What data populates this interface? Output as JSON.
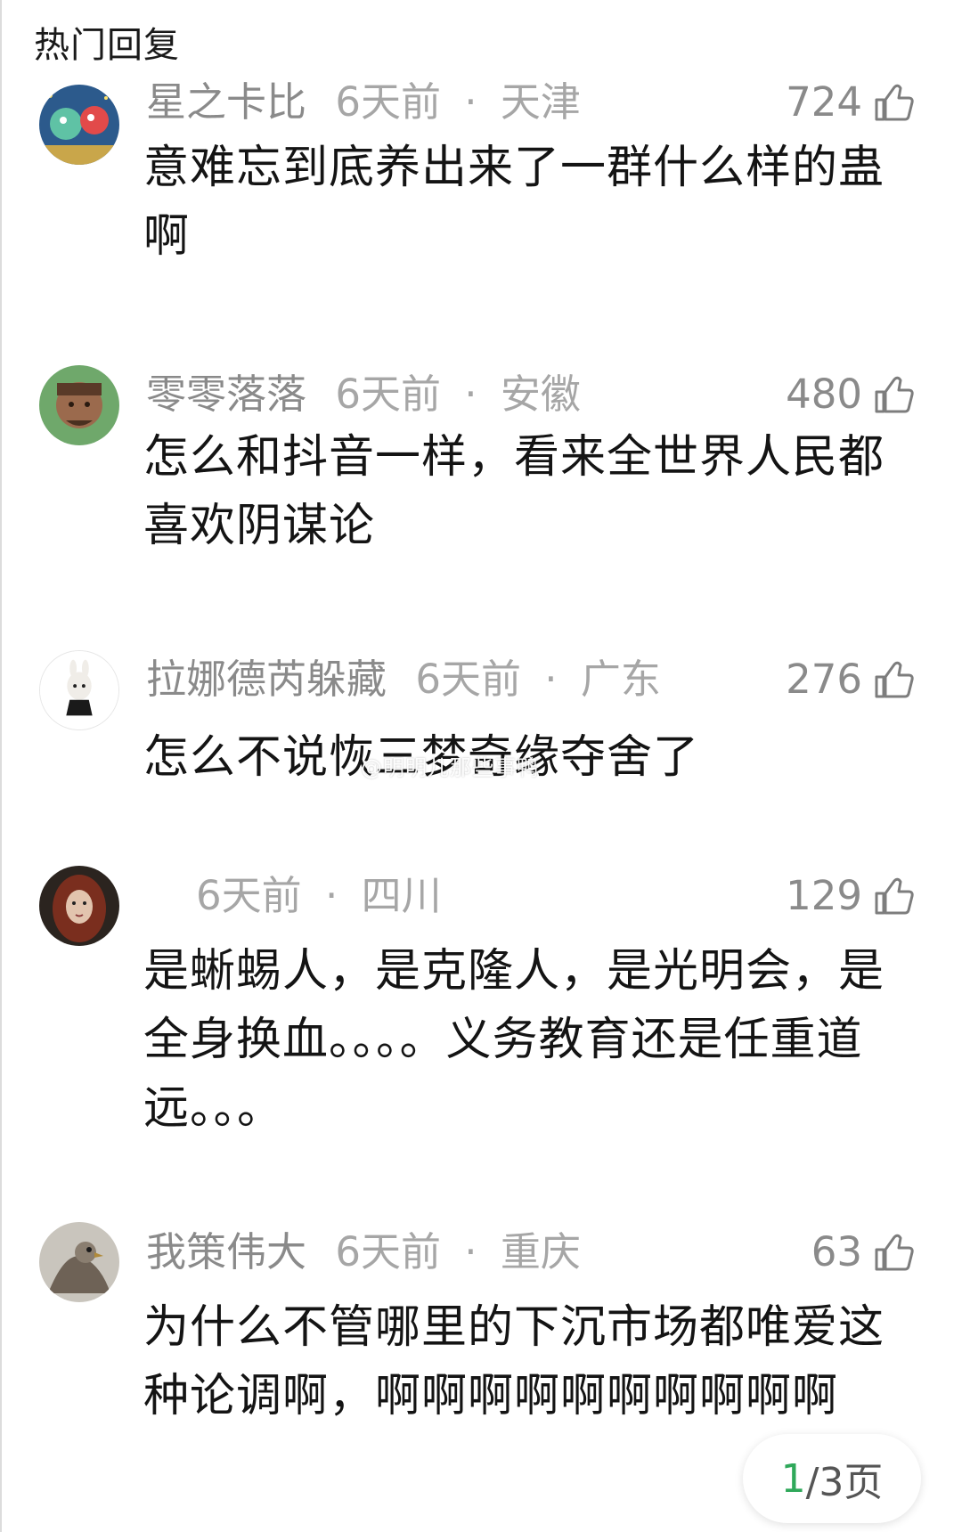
{
  "header": {
    "title": "热门回复"
  },
  "comments": [
    {
      "user": "星之卡比",
      "time": "6天前",
      "region": "天津",
      "likes": "724",
      "text": "意难忘到底养出来了一群什么样的蛊啊"
    },
    {
      "user": "零零落落",
      "time": "6天前",
      "region": "安徽",
      "likes": "480",
      "text": "怎么和抖音一样，看来全世界人民都喜欢阴谋论"
    },
    {
      "user": "拉娜德芮躲藏",
      "time": "6天前",
      "region": "广东",
      "likes": "276",
      "text": "怎么不说恢三梦奇缘夺舍了"
    },
    {
      "user": "",
      "time": "6天前",
      "region": "四川",
      "likes": "129",
      "text": "是蜥蜴人，是克隆人，是光明会，是全身换血。。。。义务教育还是任重道远。。。"
    },
    {
      "user": "我策伟大",
      "time": "6天前",
      "region": "重庆",
      "likes": "63",
      "text": "为什么不管哪里的下沉市场都唯爱这种论调啊，啊啊啊啊啊啊啊啊啊啊"
    }
  ],
  "watermark": "@明明儿那些事鸭",
  "pager": {
    "current": "1",
    "total": "/3页"
  },
  "icons": {
    "like": "thumbs-up-icon"
  },
  "colors": {
    "meta": "#8a8a8a",
    "text": "#141414",
    "pager_accent": "#2fa85a"
  }
}
